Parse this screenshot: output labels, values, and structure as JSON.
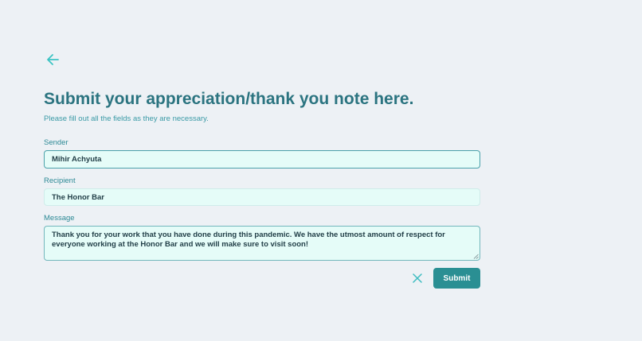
{
  "header": {
    "back_icon": "arrow-left-icon",
    "title": "Submit your appreciation/thank you note here.",
    "subtitle": "Please fill out all the fields as they are necessary."
  },
  "form": {
    "sender": {
      "label": "Sender",
      "value": "Mihir Achyuta"
    },
    "recipient": {
      "label": "Recipient",
      "value": "The Honor Bar"
    },
    "message": {
      "label": "Message",
      "value": "Thank you for your work that you have done during this pandemic. We have the utmost amount of respect for everyone working at the Honor Bar and we will make sure to visit soon!"
    },
    "clear_icon": "close-icon",
    "submit_label": "Submit"
  },
  "colors": {
    "background": "#edf1f5",
    "accent": "#2a8f93",
    "title": "#2b7480",
    "field_background": "#e5fcf8"
  }
}
